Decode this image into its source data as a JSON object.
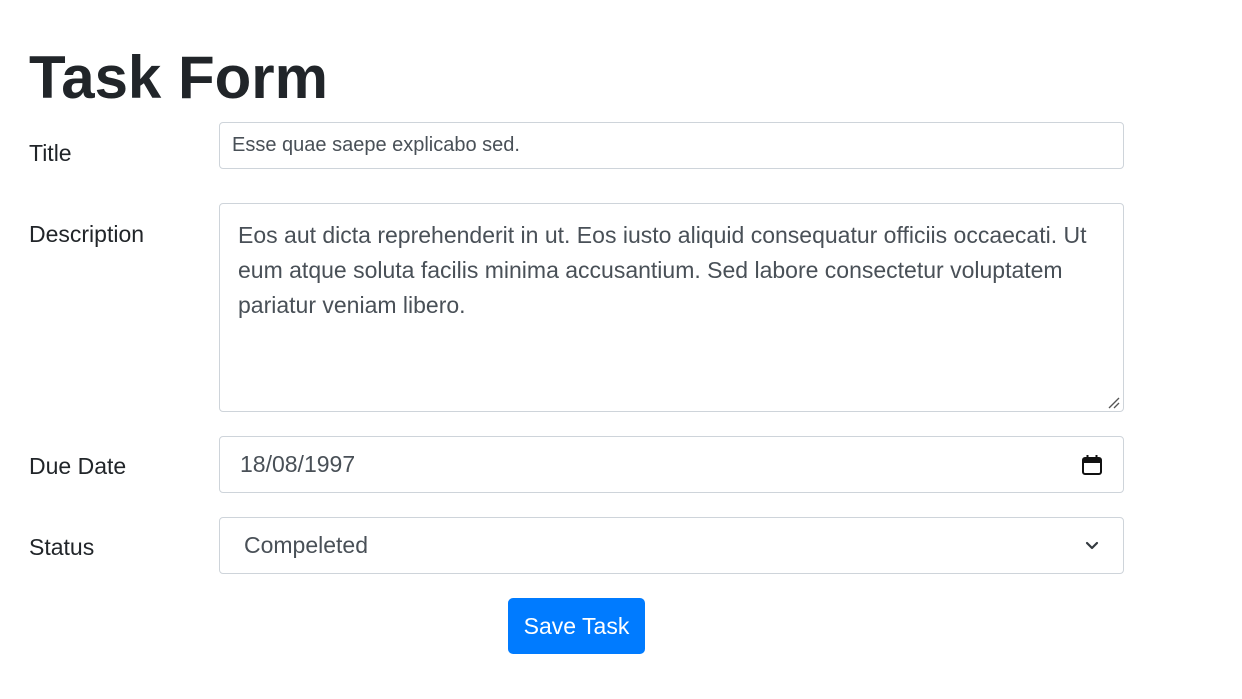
{
  "page": {
    "title": "Task Form"
  },
  "form": {
    "title": {
      "label": "Title",
      "value": "Esse quae saepe explicabo sed."
    },
    "description": {
      "label": "Description",
      "value": "Eos aut dicta reprehenderit in ut. Eos iusto aliquid consequatur officiis occaecati. Ut eum atque soluta facilis minima accusantium. Sed labore consectetur voluptatem pariatur veniam libero."
    },
    "due_date": {
      "label": "Due Date",
      "value": "18/08/1997",
      "icon": "calendar-icon"
    },
    "status": {
      "label": "Status",
      "selected": "Compeleted",
      "icon": "chevron-down-icon"
    },
    "submit_label": "Save Task"
  },
  "colors": {
    "primary": "#007bff",
    "text": "#212529",
    "field_text": "#495057",
    "border": "#ced4da"
  }
}
